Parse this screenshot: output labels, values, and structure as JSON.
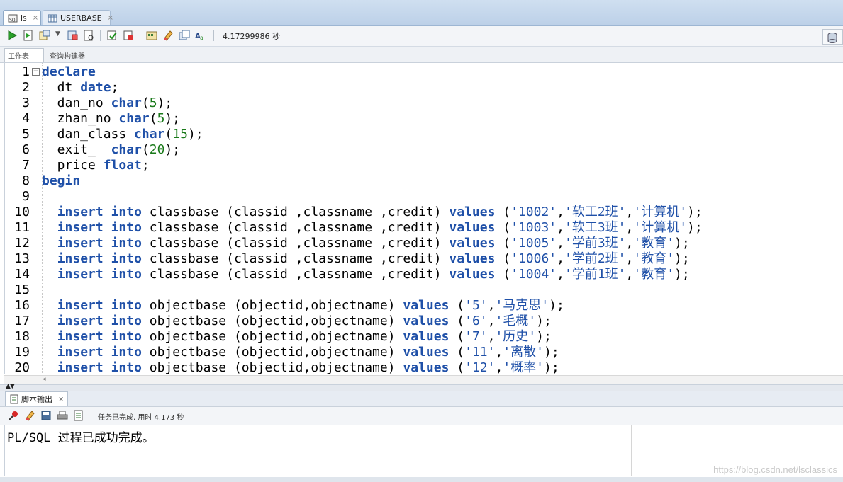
{
  "tabs": [
    {
      "label": "ls",
      "close": "×"
    },
    {
      "label": "USERBASE",
      "close": "×"
    }
  ],
  "toolbar": {
    "icons": [
      "run-statement-icon",
      "run-script-icon",
      "explain-plan-icon",
      "autotrace-icon",
      "sql-tuning-icon",
      "commit-icon",
      "rollback-icon",
      "sql-history-icon",
      "clear-icon",
      "format-icon",
      "find-icon"
    ],
    "timer": "4.17299986 秒"
  },
  "subtabs": {
    "worksheet": "工作表",
    "query_builder": "查询构建器"
  },
  "editor": {
    "lines": [
      {
        "n": "1",
        "html": "<span class=\"kw\">declare</span>"
      },
      {
        "n": "2",
        "html": "  dt <span class=\"kw\">date</span>;"
      },
      {
        "n": "3",
        "html": "  dan_no <span class=\"kw\">char</span>(<span class=\"num\">5</span>);"
      },
      {
        "n": "4",
        "html": "  zhan_no <span class=\"kw\">char</span>(<span class=\"num\">5</span>);"
      },
      {
        "n": "5",
        "html": "  dan_class <span class=\"kw\">char</span>(<span class=\"num\">15</span>);"
      },
      {
        "n": "6",
        "html": "  exit_  <span class=\"kw\">char</span>(<span class=\"num\">20</span>);"
      },
      {
        "n": "7",
        "html": "  price <span class=\"kw\">float</span>;"
      },
      {
        "n": "8",
        "html": "<span class=\"kw\">begin</span>"
      },
      {
        "n": "9",
        "html": ""
      },
      {
        "n": "10",
        "html": "  <span class=\"kw\">insert</span> <span class=\"kw\">into</span> classbase (classid ,classname ,credit) <span class=\"kw\">values</span> (<span class=\"str\">'1002'</span>,<span class=\"str\">'软工2班'</span>,<span class=\"str\">'计算机'</span>);"
      },
      {
        "n": "11",
        "html": "  <span class=\"kw\">insert</span> <span class=\"kw\">into</span> classbase (classid ,classname ,credit) <span class=\"kw\">values</span> (<span class=\"str\">'1003'</span>,<span class=\"str\">'软工3班'</span>,<span class=\"str\">'计算机'</span>);"
      },
      {
        "n": "12",
        "html": "  <span class=\"kw\">insert</span> <span class=\"kw\">into</span> classbase (classid ,classname ,credit) <span class=\"kw\">values</span> (<span class=\"str\">'1005'</span>,<span class=\"str\">'学前3班'</span>,<span class=\"str\">'教育'</span>);"
      },
      {
        "n": "13",
        "html": "  <span class=\"kw\">insert</span> <span class=\"kw\">into</span> classbase (classid ,classname ,credit) <span class=\"kw\">values</span> (<span class=\"str\">'1006'</span>,<span class=\"str\">'学前2班'</span>,<span class=\"str\">'教育'</span>);"
      },
      {
        "n": "14",
        "html": "  <span class=\"kw\">insert</span> <span class=\"kw\">into</span> classbase (classid ,classname ,credit) <span class=\"kw\">values</span> (<span class=\"str\">'1004'</span>,<span class=\"str\">'学前1班'</span>,<span class=\"str\">'教育'</span>);"
      },
      {
        "n": "15",
        "html": ""
      },
      {
        "n": "16",
        "html": "  <span class=\"kw\">insert</span> <span class=\"kw\">into</span> objectbase (objectid,objectname) <span class=\"kw\">values</span> (<span class=\"str\">'5'</span>,<span class=\"str\">'马克思'</span>);"
      },
      {
        "n": "17",
        "html": "  <span class=\"kw\">insert</span> <span class=\"kw\">into</span> objectbase (objectid,objectname) <span class=\"kw\">values</span> (<span class=\"str\">'6'</span>,<span class=\"str\">'毛概'</span>);"
      },
      {
        "n": "18",
        "html": "  <span class=\"kw\">insert</span> <span class=\"kw\">into</span> objectbase (objectid,objectname) <span class=\"kw\">values</span> (<span class=\"str\">'7'</span>,<span class=\"str\">'历史'</span>);"
      },
      {
        "n": "19",
        "html": "  <span class=\"kw\">insert</span> <span class=\"kw\">into</span> objectbase (objectid,objectname) <span class=\"kw\">values</span> (<span class=\"str\">'11'</span>,<span class=\"str\">'离散'</span>);"
      },
      {
        "n": "20",
        "html": "  <span class=\"kw\">insert</span> <span class=\"kw\">into</span> objectbase (objectid,objectname) <span class=\"kw\">values</span> (<span class=\"str\">'12'</span>,<span class=\"str\">'概率'</span>);"
      }
    ]
  },
  "output_panel": {
    "tab_label": "脚本输出",
    "tab_close": "×",
    "status": "任务已完成, 用时 4.173 秒",
    "text": "PL/SQL 过程已成功完成。"
  },
  "watermark": "https://blog.csdn.net/lsclassics"
}
